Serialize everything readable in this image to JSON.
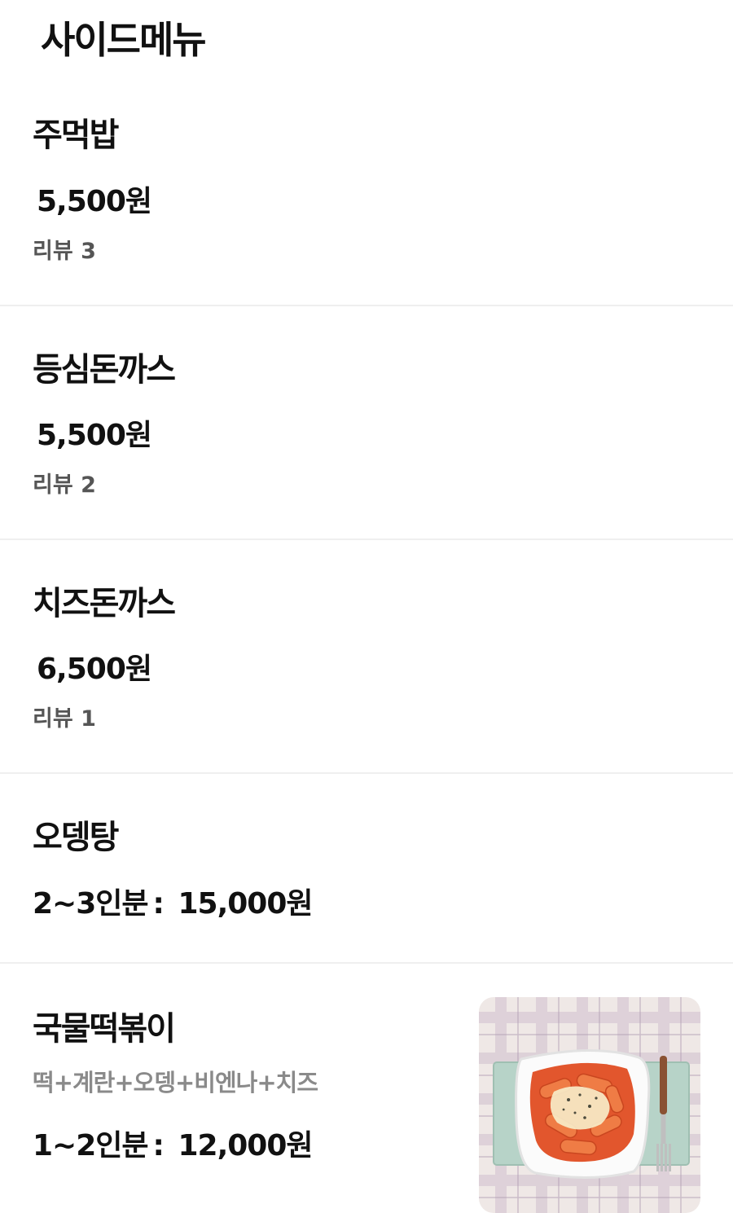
{
  "header": {
    "title": "사이드메뉴"
  },
  "items": [
    {
      "name": "주먹밥",
      "price": "5,500원",
      "reviews": "리뷰 3"
    },
    {
      "name": "등심돈까스",
      "price": "5,500원",
      "reviews": "리뷰 2"
    },
    {
      "name": "치즈돈까스",
      "price": "6,500원",
      "reviews": "리뷰 1"
    },
    {
      "name": "오뎅탕",
      "serving": "2~3인분",
      "separator": ":",
      "price": "15,000원"
    },
    {
      "name": "국물떡볶이",
      "description": "떡+계란+오뎅+비엔나+치즈",
      "serving": "1~2인분",
      "separator": ":",
      "price": "12,000원",
      "image_icon": "tteokbokki-photo"
    }
  ],
  "colors": {
    "text_primary": "#111111",
    "text_secondary": "#555555",
    "text_description": "#8a8a8a",
    "divider": "#efefef",
    "background": "#ffffff"
  }
}
